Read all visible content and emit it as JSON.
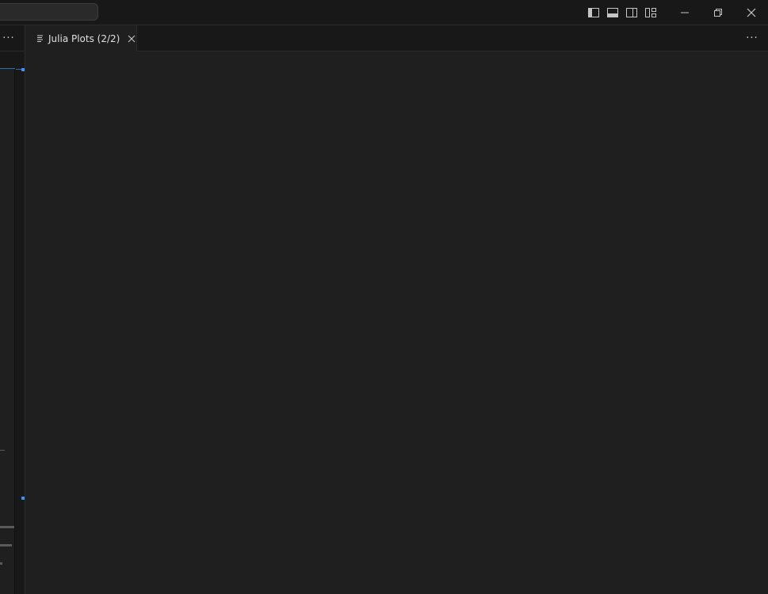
{
  "titlebar": {
    "layout_icons": [
      "toggle-primary-sidebar-icon",
      "toggle-panel-icon",
      "toggle-secondary-sidebar-icon",
      "customize-layout-icon"
    ],
    "window_controls": [
      "minimize-icon",
      "restore-icon",
      "close-icon"
    ]
  },
  "sidebar": {
    "more_label": "···"
  },
  "tabs": [
    {
      "label": "Julia Plots (2/2)",
      "icon": "preview-icon",
      "active": true
    }
  ],
  "tabbar": {
    "more_label": "···"
  },
  "colors": {
    "background": "#1f1f1f",
    "titlebar": "#181818",
    "accent": "#3794ff"
  }
}
